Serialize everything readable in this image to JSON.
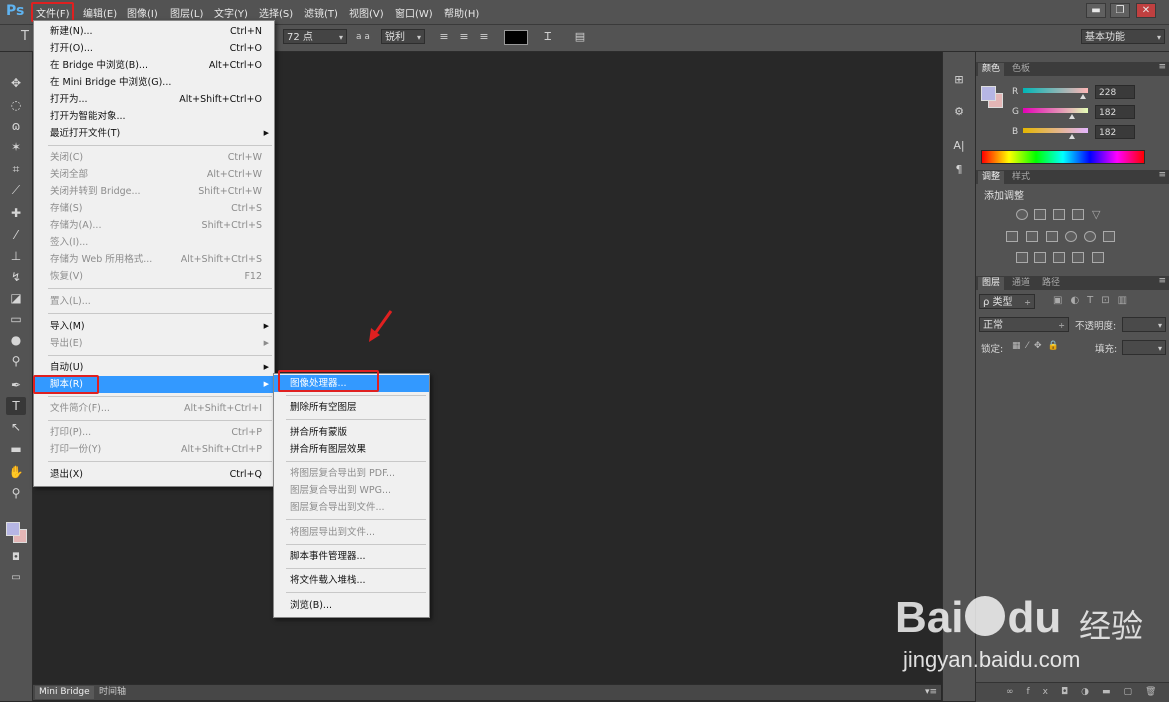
{
  "app": {
    "logo": "Ps"
  },
  "menubar": {
    "items": [
      "文件(F)",
      "编辑(E)",
      "图像(I)",
      "图层(L)",
      "文字(Y)",
      "选择(S)",
      "滤镜(T)",
      "视图(V)",
      "窗口(W)",
      "帮助(H)"
    ],
    "window_buttons": [
      "▬",
      "❐",
      "✕"
    ]
  },
  "options": {
    "tool_glyph": "T",
    "font_size": "72 点",
    "aa_label": "a a",
    "antialias": "锐利",
    "workspace": "基本功能",
    "text_color": "#000000"
  },
  "file_menu": {
    "items": [
      {
        "label": "新建(N)...",
        "shortcut": "Ctrl+N"
      },
      {
        "label": "打开(O)...",
        "shortcut": "Ctrl+O"
      },
      {
        "label": "在 Bridge 中浏览(B)...",
        "shortcut": "Alt+Ctrl+O"
      },
      {
        "label": "在 Mini Bridge 中浏览(G)...",
        "shortcut": ""
      },
      {
        "label": "打开为...",
        "shortcut": "Alt+Shift+Ctrl+O"
      },
      {
        "label": "打开为智能对象...",
        "shortcut": ""
      },
      {
        "label": "最近打开文件(T)",
        "shortcut": ""
      },
      {
        "label": "关闭(C)",
        "shortcut": "Ctrl+W"
      },
      {
        "label": "关闭全部",
        "shortcut": "Alt+Ctrl+W"
      },
      {
        "label": "关闭并转到 Bridge...",
        "shortcut": "Shift+Ctrl+W"
      },
      {
        "label": "存储(S)",
        "shortcut": "Ctrl+S"
      },
      {
        "label": "存储为(A)...",
        "shortcut": "Shift+Ctrl+S"
      },
      {
        "label": "签入(I)...",
        "shortcut": ""
      },
      {
        "label": "存储为 Web 所用格式...",
        "shortcut": "Alt+Shift+Ctrl+S"
      },
      {
        "label": "恢复(V)",
        "shortcut": "F12"
      },
      {
        "label": "置入(L)...",
        "shortcut": ""
      },
      {
        "label": "导入(M)",
        "shortcut": ""
      },
      {
        "label": "导出(E)",
        "shortcut": ""
      },
      {
        "label": "自动(U)",
        "shortcut": ""
      },
      {
        "label": "脚本(R)",
        "shortcut": ""
      },
      {
        "label": "文件简介(F)...",
        "shortcut": "Alt+Shift+Ctrl+I"
      },
      {
        "label": "打印(P)...",
        "shortcut": "Ctrl+P"
      },
      {
        "label": "打印一份(Y)",
        "shortcut": "Alt+Shift+Ctrl+P"
      },
      {
        "label": "退出(X)",
        "shortcut": "Ctrl+Q"
      }
    ]
  },
  "script_menu": {
    "items": [
      "图像处理器...",
      "删除所有空图层",
      "拼合所有蒙版",
      "拼合所有图层效果",
      "将图层复合导出到 PDF...",
      "图层复合导出到 WPG...",
      "图层复合导出到文件...",
      "将图层导出到文件...",
      "脚本事件管理器...",
      "将文件载入堆栈...",
      "浏览(B)..."
    ]
  },
  "color_panel": {
    "tabs": [
      "颜色",
      "色板"
    ],
    "channels": [
      {
        "label": "R",
        "value": "228"
      },
      {
        "label": "G",
        "value": "182"
      },
      {
        "label": "B",
        "value": "182"
      }
    ],
    "fg_color": "#b6b6e4",
    "bg_color": "#e4b6b6"
  },
  "adjust_panel": {
    "tabs": [
      "调整",
      "样式"
    ],
    "title": "添加调整"
  },
  "layers_panel": {
    "tabs": [
      "图层",
      "通道",
      "路径"
    ],
    "filter": "ρ 类型",
    "blend_mode": "正常",
    "opacity_label": "不透明度:",
    "lock_label": "锁定:",
    "fill_label": "填充:"
  },
  "bottom_tabs": [
    "Mini Bridge",
    "时间轴"
  ],
  "watermark": {
    "brand": "Bai",
    "brand2": "du",
    "brand_cn": "经验",
    "url": "jingyan.baidu.com"
  }
}
